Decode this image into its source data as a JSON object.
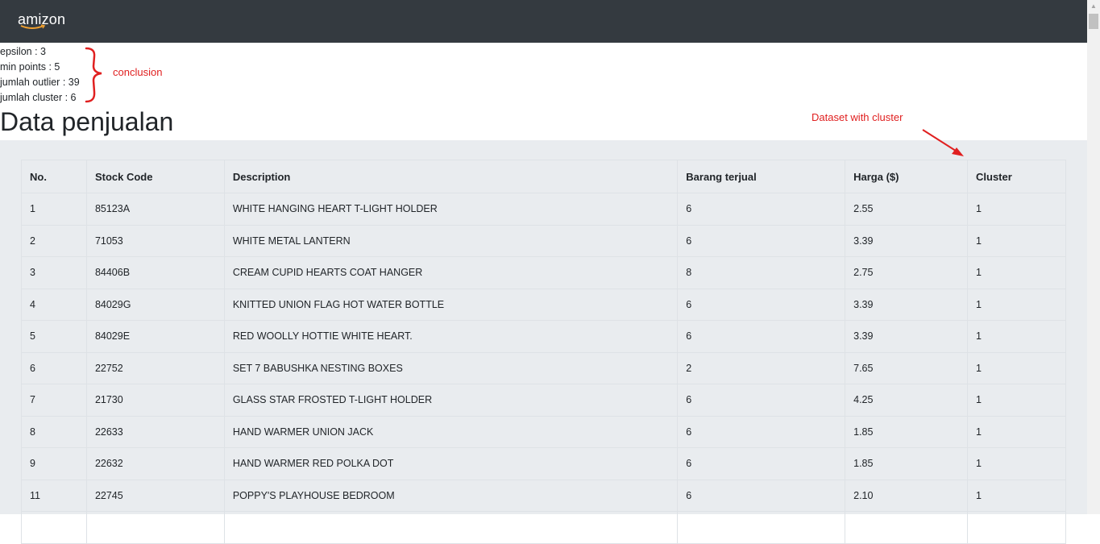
{
  "navbar": {
    "brand": "amizon"
  },
  "stats": [
    "epsilon : 3",
    "min points : 5",
    "jumlah outlier : 39",
    "jumlah cluster : 6"
  ],
  "annotations": {
    "conclusion": "conclusion",
    "dataset": "Dataset with cluster",
    "color": "#e02020"
  },
  "page_title": "Data penjualan",
  "table": {
    "headers": [
      "No.",
      "Stock Code",
      "Description",
      "Barang terjual",
      "Harga ($)",
      "Cluster"
    ],
    "rows": [
      [
        "1",
        "85123A",
        "WHITE HANGING HEART T-LIGHT HOLDER",
        "6",
        "2.55",
        "1"
      ],
      [
        "2",
        "71053",
        "WHITE METAL LANTERN",
        "6",
        "3.39",
        "1"
      ],
      [
        "3",
        "84406B",
        "CREAM CUPID HEARTS COAT HANGER",
        "8",
        "2.75",
        "1"
      ],
      [
        "4",
        "84029G",
        "KNITTED UNION FLAG HOT WATER BOTTLE",
        "6",
        "3.39",
        "1"
      ],
      [
        "5",
        "84029E",
        "RED WOOLLY HOTTIE WHITE HEART.",
        "6",
        "3.39",
        "1"
      ],
      [
        "6",
        "22752",
        "SET 7 BABUSHKA NESTING BOXES",
        "2",
        "7.65",
        "1"
      ],
      [
        "7",
        "21730",
        "GLASS STAR FROSTED T-LIGHT HOLDER",
        "6",
        "4.25",
        "1"
      ],
      [
        "8",
        "22633",
        "HAND WARMER UNION JACK",
        "6",
        "1.85",
        "1"
      ],
      [
        "9",
        "22632",
        "HAND WARMER RED POLKA DOT",
        "6",
        "1.85",
        "1"
      ],
      [
        "11",
        "22745",
        "POPPY'S PLAYHOUSE BEDROOM",
        "6",
        "2.10",
        "1"
      ],
      [
        "",
        "",
        "",
        "",
        "",
        ""
      ]
    ]
  },
  "colors": {
    "navbar": "#343a40",
    "panel": "#e9ecef",
    "border": "#dee2e6",
    "annotation": "#e02020"
  }
}
